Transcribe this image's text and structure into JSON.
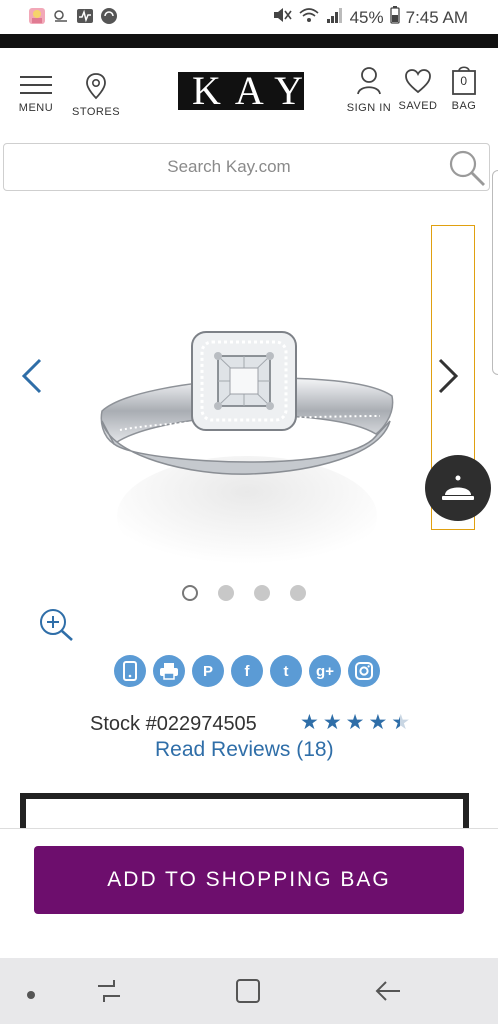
{
  "status_bar": {
    "battery": "45%",
    "time": "7:45 AM"
  },
  "header": {
    "menu_label": "MENU",
    "stores_label": "STORES",
    "logo_text": "KAY",
    "sign_in_label": "SIGN IN",
    "saved_label": "SAVED",
    "bag_label": "BAG",
    "bag_count": "0"
  },
  "search": {
    "placeholder": "Search Kay.com"
  },
  "carousel": {
    "slide_count": 4,
    "active_index": 0
  },
  "social_icons": [
    "mobile-icon",
    "print-icon",
    "pinterest-icon",
    "facebook-icon",
    "twitter-icon",
    "google-plus-icon",
    "instagram-icon"
  ],
  "social_glyphs": {
    "pinterest": "P",
    "facebook": "f",
    "twitter": "t",
    "google_plus": "g+"
  },
  "product": {
    "stock": "Stock #022974505",
    "rating": 4.5,
    "rating_max": 5,
    "reviews_link": "Read Reviews (18)"
  },
  "cta": {
    "add_to_bag": "ADD TO SHOPPING BAG"
  },
  "colors": {
    "accent_blue": "#2f6ea8",
    "social_blue": "#5b9bd5",
    "cta_purple": "#6d0e6d",
    "thumb_border": "#e0a010"
  }
}
